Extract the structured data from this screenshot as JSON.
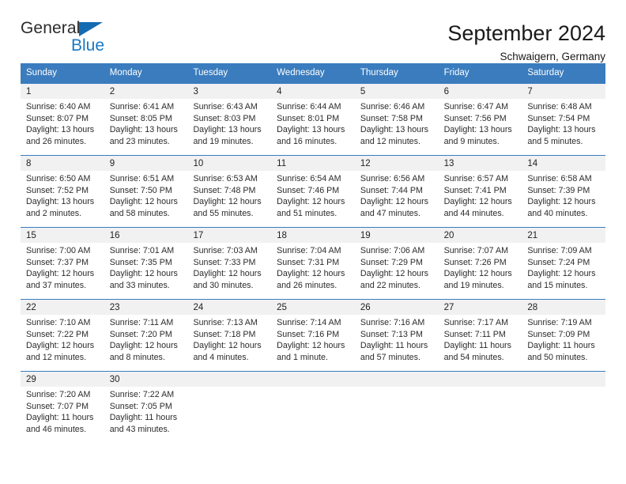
{
  "logo": {
    "word1": "General",
    "word2": "Blue",
    "triangle_color": "#156bb1",
    "blue_color": "#1878c4"
  },
  "header": {
    "title": "September 2024",
    "subtitle": "Schwaigern, Germany"
  },
  "theme": {
    "header_row_bg": "#3a7cbe",
    "daynum_band_bg": "#f1f1f1",
    "separator": "#3a7cbe"
  },
  "weekdays": [
    "Sunday",
    "Monday",
    "Tuesday",
    "Wednesday",
    "Thursday",
    "Friday",
    "Saturday"
  ],
  "weeks": [
    [
      {
        "day": "1",
        "sunrise": "Sunrise: 6:40 AM",
        "sunset": "Sunset: 8:07 PM",
        "daylight1": "Daylight: 13 hours",
        "daylight2": "and 26 minutes."
      },
      {
        "day": "2",
        "sunrise": "Sunrise: 6:41 AM",
        "sunset": "Sunset: 8:05 PM",
        "daylight1": "Daylight: 13 hours",
        "daylight2": "and 23 minutes."
      },
      {
        "day": "3",
        "sunrise": "Sunrise: 6:43 AM",
        "sunset": "Sunset: 8:03 PM",
        "daylight1": "Daylight: 13 hours",
        "daylight2": "and 19 minutes."
      },
      {
        "day": "4",
        "sunrise": "Sunrise: 6:44 AM",
        "sunset": "Sunset: 8:01 PM",
        "daylight1": "Daylight: 13 hours",
        "daylight2": "and 16 minutes."
      },
      {
        "day": "5",
        "sunrise": "Sunrise: 6:46 AM",
        "sunset": "Sunset: 7:58 PM",
        "daylight1": "Daylight: 13 hours",
        "daylight2": "and 12 minutes."
      },
      {
        "day": "6",
        "sunrise": "Sunrise: 6:47 AM",
        "sunset": "Sunset: 7:56 PM",
        "daylight1": "Daylight: 13 hours",
        "daylight2": "and 9 minutes."
      },
      {
        "day": "7",
        "sunrise": "Sunrise: 6:48 AM",
        "sunset": "Sunset: 7:54 PM",
        "daylight1": "Daylight: 13 hours",
        "daylight2": "and 5 minutes."
      }
    ],
    [
      {
        "day": "8",
        "sunrise": "Sunrise: 6:50 AM",
        "sunset": "Sunset: 7:52 PM",
        "daylight1": "Daylight: 13 hours",
        "daylight2": "and 2 minutes."
      },
      {
        "day": "9",
        "sunrise": "Sunrise: 6:51 AM",
        "sunset": "Sunset: 7:50 PM",
        "daylight1": "Daylight: 12 hours",
        "daylight2": "and 58 minutes."
      },
      {
        "day": "10",
        "sunrise": "Sunrise: 6:53 AM",
        "sunset": "Sunset: 7:48 PM",
        "daylight1": "Daylight: 12 hours",
        "daylight2": "and 55 minutes."
      },
      {
        "day": "11",
        "sunrise": "Sunrise: 6:54 AM",
        "sunset": "Sunset: 7:46 PM",
        "daylight1": "Daylight: 12 hours",
        "daylight2": "and 51 minutes."
      },
      {
        "day": "12",
        "sunrise": "Sunrise: 6:56 AM",
        "sunset": "Sunset: 7:44 PM",
        "daylight1": "Daylight: 12 hours",
        "daylight2": "and 47 minutes."
      },
      {
        "day": "13",
        "sunrise": "Sunrise: 6:57 AM",
        "sunset": "Sunset: 7:41 PM",
        "daylight1": "Daylight: 12 hours",
        "daylight2": "and 44 minutes."
      },
      {
        "day": "14",
        "sunrise": "Sunrise: 6:58 AM",
        "sunset": "Sunset: 7:39 PM",
        "daylight1": "Daylight: 12 hours",
        "daylight2": "and 40 minutes."
      }
    ],
    [
      {
        "day": "15",
        "sunrise": "Sunrise: 7:00 AM",
        "sunset": "Sunset: 7:37 PM",
        "daylight1": "Daylight: 12 hours",
        "daylight2": "and 37 minutes."
      },
      {
        "day": "16",
        "sunrise": "Sunrise: 7:01 AM",
        "sunset": "Sunset: 7:35 PM",
        "daylight1": "Daylight: 12 hours",
        "daylight2": "and 33 minutes."
      },
      {
        "day": "17",
        "sunrise": "Sunrise: 7:03 AM",
        "sunset": "Sunset: 7:33 PM",
        "daylight1": "Daylight: 12 hours",
        "daylight2": "and 30 minutes."
      },
      {
        "day": "18",
        "sunrise": "Sunrise: 7:04 AM",
        "sunset": "Sunset: 7:31 PM",
        "daylight1": "Daylight: 12 hours",
        "daylight2": "and 26 minutes."
      },
      {
        "day": "19",
        "sunrise": "Sunrise: 7:06 AM",
        "sunset": "Sunset: 7:29 PM",
        "daylight1": "Daylight: 12 hours",
        "daylight2": "and 22 minutes."
      },
      {
        "day": "20",
        "sunrise": "Sunrise: 7:07 AM",
        "sunset": "Sunset: 7:26 PM",
        "daylight1": "Daylight: 12 hours",
        "daylight2": "and 19 minutes."
      },
      {
        "day": "21",
        "sunrise": "Sunrise: 7:09 AM",
        "sunset": "Sunset: 7:24 PM",
        "daylight1": "Daylight: 12 hours",
        "daylight2": "and 15 minutes."
      }
    ],
    [
      {
        "day": "22",
        "sunrise": "Sunrise: 7:10 AM",
        "sunset": "Sunset: 7:22 PM",
        "daylight1": "Daylight: 12 hours",
        "daylight2": "and 12 minutes."
      },
      {
        "day": "23",
        "sunrise": "Sunrise: 7:11 AM",
        "sunset": "Sunset: 7:20 PM",
        "daylight1": "Daylight: 12 hours",
        "daylight2": "and 8 minutes."
      },
      {
        "day": "24",
        "sunrise": "Sunrise: 7:13 AM",
        "sunset": "Sunset: 7:18 PM",
        "daylight1": "Daylight: 12 hours",
        "daylight2": "and 4 minutes."
      },
      {
        "day": "25",
        "sunrise": "Sunrise: 7:14 AM",
        "sunset": "Sunset: 7:16 PM",
        "daylight1": "Daylight: 12 hours",
        "daylight2": "and 1 minute."
      },
      {
        "day": "26",
        "sunrise": "Sunrise: 7:16 AM",
        "sunset": "Sunset: 7:13 PM",
        "daylight1": "Daylight: 11 hours",
        "daylight2": "and 57 minutes."
      },
      {
        "day": "27",
        "sunrise": "Sunrise: 7:17 AM",
        "sunset": "Sunset: 7:11 PM",
        "daylight1": "Daylight: 11 hours",
        "daylight2": "and 54 minutes."
      },
      {
        "day": "28",
        "sunrise": "Sunrise: 7:19 AM",
        "sunset": "Sunset: 7:09 PM",
        "daylight1": "Daylight: 11 hours",
        "daylight2": "and 50 minutes."
      }
    ],
    [
      {
        "day": "29",
        "sunrise": "Sunrise: 7:20 AM",
        "sunset": "Sunset: 7:07 PM",
        "daylight1": "Daylight: 11 hours",
        "daylight2": "and 46 minutes."
      },
      {
        "day": "30",
        "sunrise": "Sunrise: 7:22 AM",
        "sunset": "Sunset: 7:05 PM",
        "daylight1": "Daylight: 11 hours",
        "daylight2": "and 43 minutes."
      },
      {
        "day": "",
        "sunrise": "",
        "sunset": "",
        "daylight1": "",
        "daylight2": ""
      },
      {
        "day": "",
        "sunrise": "",
        "sunset": "",
        "daylight1": "",
        "daylight2": ""
      },
      {
        "day": "",
        "sunrise": "",
        "sunset": "",
        "daylight1": "",
        "daylight2": ""
      },
      {
        "day": "",
        "sunrise": "",
        "sunset": "",
        "daylight1": "",
        "daylight2": ""
      },
      {
        "day": "",
        "sunrise": "",
        "sunset": "",
        "daylight1": "",
        "daylight2": ""
      }
    ]
  ]
}
